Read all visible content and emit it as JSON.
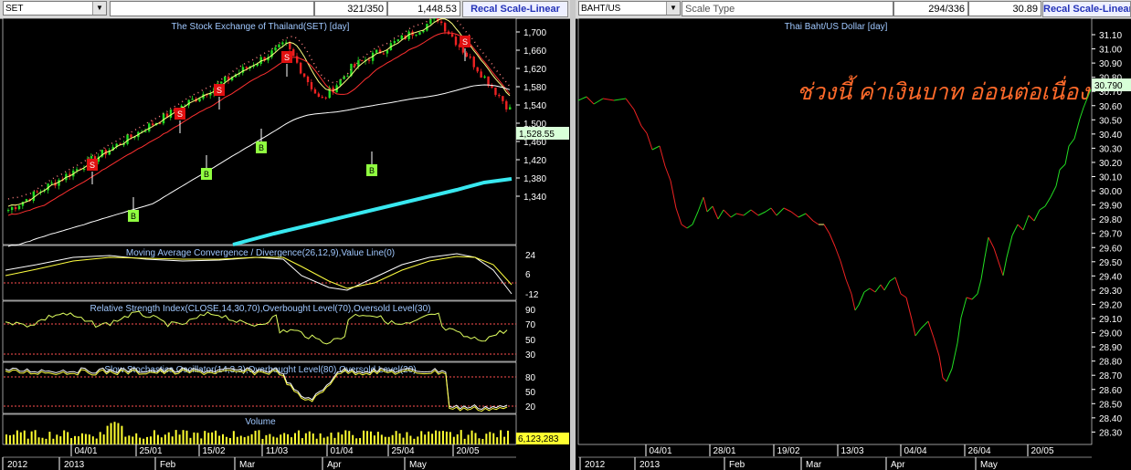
{
  "left": {
    "symbol": "SET",
    "field1": "",
    "field2": "321/350",
    "field3": "1,448.53",
    "recal_label": "Recal Scale-Linear",
    "title": "The Stock Exchange of Thailand(SET) [day]",
    "price_ticks": [
      "1,700",
      "1,660",
      "1,620",
      "1,580",
      "1,540",
      "1,500",
      "1,460",
      "1,420",
      "1,380",
      "1,340"
    ],
    "price_label": "1,528.55",
    "macd_title": "Moving Average Convergence / Divergence(26,12,9),Value Line(0)",
    "macd_ticks": [
      "24",
      "6",
      "-12"
    ],
    "rsi_title": "Relative Strength Index(CLOSE,14,30,70),Overbought Level(70),Oversold Level(30)",
    "rsi_ticks": [
      "90",
      "70",
      "50",
      "30"
    ],
    "stoch_title": "Slow Stochastics Oscillator(14,3,3),Overbought Level(80),Oversold Level(20)",
    "stoch_ticks": [
      "80",
      "50",
      "20"
    ],
    "volume_title": "Volume",
    "volume_label": "6,123,283",
    "date_labels": [
      "04/01",
      "25/01",
      "15/02",
      "11/03",
      "01/04",
      "25/04",
      "20/05"
    ],
    "year_labels": [
      "2012",
      "2013",
      "Feb",
      "Mar",
      "Apr",
      "May"
    ],
    "signals_s": [
      "S",
      "S",
      "S",
      "S",
      "S"
    ],
    "signals_b": [
      "B",
      "B",
      "B",
      "B"
    ]
  },
  "right": {
    "symbol": "BAHT/US",
    "scale_type": "Scale Type",
    "field2": "294/336",
    "field3": "30.89",
    "recal_label": "Recal Scale-Linear",
    "title": "Thai Baht/US Dollar [day]",
    "annotation": "ช่วงนี้ ค่าเงินบาท อ่อนต่อเนื่อง",
    "price_label": "30.790",
    "price_ticks": [
      "31.10",
      "31.00",
      "30.90",
      "30.80",
      "30.70",
      "30.60",
      "30.50",
      "30.40",
      "30.30",
      "30.20",
      "30.10",
      "30.00",
      "29.90",
      "29.80",
      "29.70",
      "29.60",
      "29.50",
      "29.40",
      "29.30",
      "29.20",
      "29.10",
      "29.00",
      "28.90",
      "28.80",
      "28.70",
      "28.60",
      "28.50",
      "28.40",
      "28.30"
    ],
    "date_labels": [
      "04/01",
      "28/01",
      "19/02",
      "13/03",
      "04/04",
      "26/04",
      "20/05"
    ],
    "year_labels": [
      "2012",
      "2013",
      "Feb",
      "Mar",
      "Apr",
      "May"
    ]
  },
  "colors": {
    "up": "#22dd22",
    "down": "#ee2222",
    "title_text": "#a0c8ff",
    "tick_text": "#ffffff",
    "annotation": "#ff6a2a",
    "sma_long": "#38e8f0"
  }
}
